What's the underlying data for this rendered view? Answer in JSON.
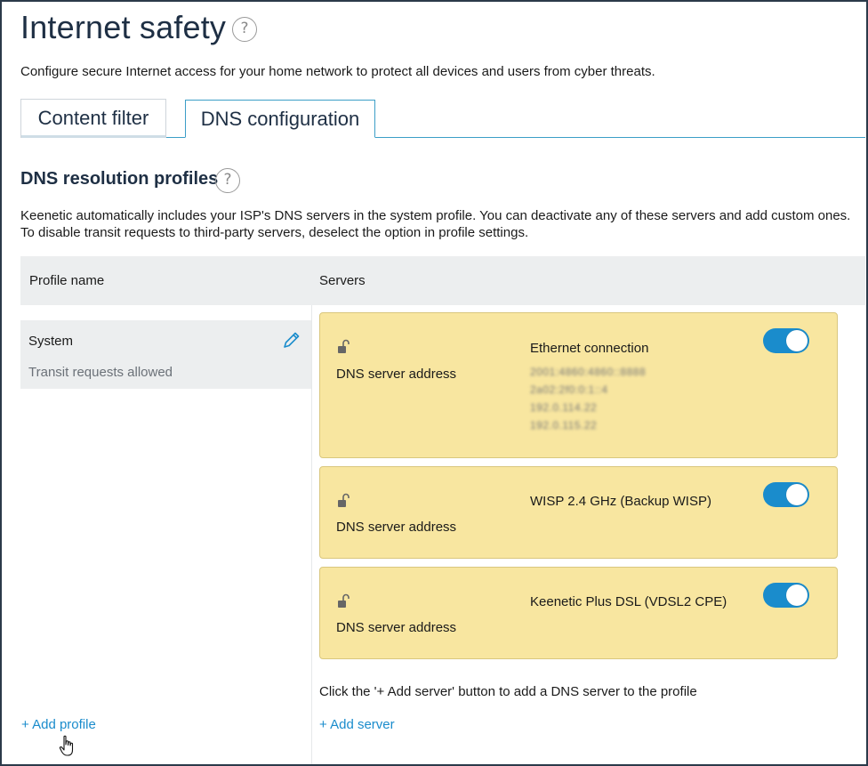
{
  "page": {
    "title": "Internet safety",
    "help_glyph": "?",
    "intro": "Configure secure Internet access for your home network to protect all devices and users from cyber threats."
  },
  "tabs": [
    {
      "label": "Content filter",
      "active": false
    },
    {
      "label": "DNS configuration",
      "active": true
    }
  ],
  "section": {
    "title": "DNS resolution profiles",
    "description_line1": "Keenetic automatically includes your ISP's DNS servers in the system profile. You can deactivate any of these servers and add custom ones.",
    "description_line2": "To disable transit requests to third-party servers, deselect the option in profile settings."
  },
  "table": {
    "col_profile": "Profile name",
    "col_servers": "Servers"
  },
  "profiles": [
    {
      "name": "System",
      "subtitle": "Transit requests allowed",
      "edit_icon": "pencil-icon"
    }
  ],
  "servers": [
    {
      "label": "DNS server address",
      "connection": "Ethernet connection",
      "enabled": true,
      "addresses": [
        "2001:4860:4860::8888",
        "2a02:2f0:0:1::4",
        "192.0.114.22",
        "192.0.115.22"
      ]
    },
    {
      "label": "DNS server address",
      "connection": "WISP 2.4 GHz (Backup WISP)",
      "enabled": true,
      "addresses": []
    },
    {
      "label": "DNS server address",
      "connection": "Keenetic Plus DSL (VDSL2 CPE)",
      "enabled": true,
      "addresses": []
    }
  ],
  "hint": "Click the '+ Add server' button to add a DNS server to the profile",
  "actions": {
    "add_profile": "+ Add profile",
    "add_server": "+ Add server"
  },
  "colors": {
    "accent": "#1a8ccc",
    "card_bg": "#f8e6a0",
    "header_bg": "#eceeef",
    "title": "#1e2f44"
  }
}
